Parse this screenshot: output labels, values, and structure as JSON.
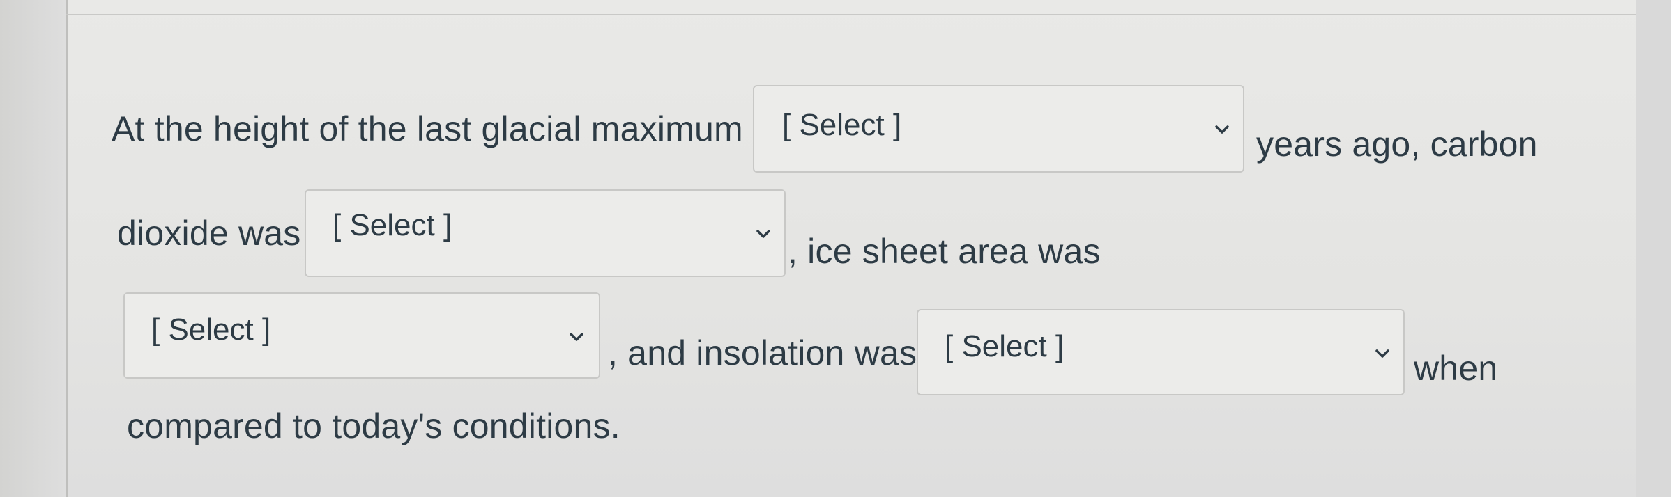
{
  "question": {
    "line1_text_a": "At the height of the last glacial maximum",
    "line1_text_b": "years ago, carbon",
    "line2_text_a": "dioxide was",
    "line2_text_b": ", ice sheet area was",
    "line3_text_a": ", and insolation was",
    "line3_text_b": "when",
    "line4_text": "compared to today's conditions."
  },
  "dropdowns": [
    {
      "selected": "[ Select ]",
      "icon": "chevron-down-icon"
    },
    {
      "selected": "[ Select ]",
      "icon": "chevron-down-icon"
    },
    {
      "selected": "[ Select ]",
      "icon": "chevron-down-icon"
    },
    {
      "selected": "[ Select ]",
      "icon": "chevron-down-icon"
    }
  ],
  "colors": {
    "text": "#2d3b45",
    "select_bg": "#ececea",
    "select_border": "#c8c8c6"
  }
}
